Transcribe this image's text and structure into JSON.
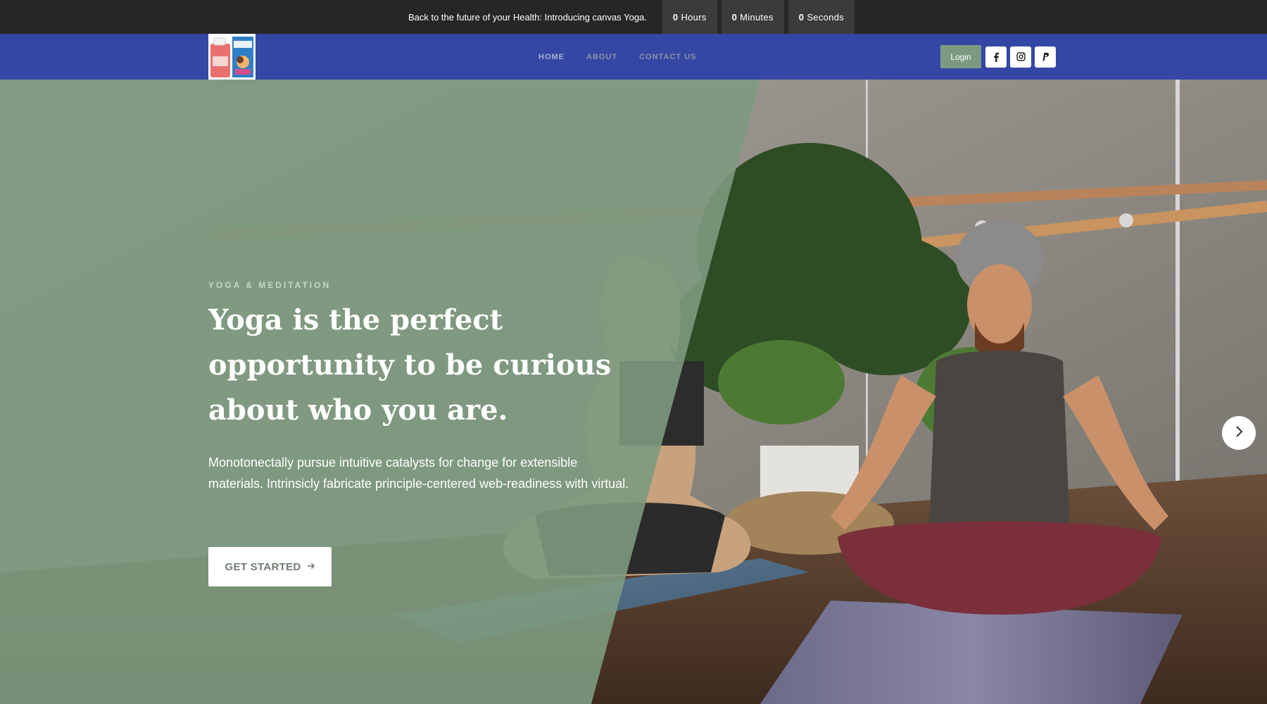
{
  "topbar": {
    "message": "Back to the future of your Health: Introducing canvas Yoga.",
    "countdown": [
      {
        "value": "0",
        "unit": "Hours"
      },
      {
        "value": "0",
        "unit": "Minutes"
      },
      {
        "value": "0",
        "unit": "Seconds"
      }
    ]
  },
  "navbar": {
    "links": [
      "HOME",
      "ABOUT",
      "CONTACT US"
    ],
    "login_label": "Login",
    "social_icons": [
      "facebook-icon",
      "instagram-icon",
      "paypal-icon"
    ]
  },
  "hero": {
    "kicker": "YOGA & MEDITATION",
    "headline": "Yoga is the perfect opportunity to be curious about who you are.",
    "description": "Monotonectally pursue intuitive catalysts for change for extensible materials. Intrinsicly fabricate principle-centered web-readiness with virtual.",
    "cta_label": "GET STARTED",
    "cta_icon": "arrow-right-icon",
    "next_icon": "chevron-right-icon"
  },
  "colors": {
    "topbar_bg": "#262626",
    "navbar_bg": "#3447a4",
    "overlay_green": "#7d9a80",
    "login_button": "#7d9a80"
  }
}
